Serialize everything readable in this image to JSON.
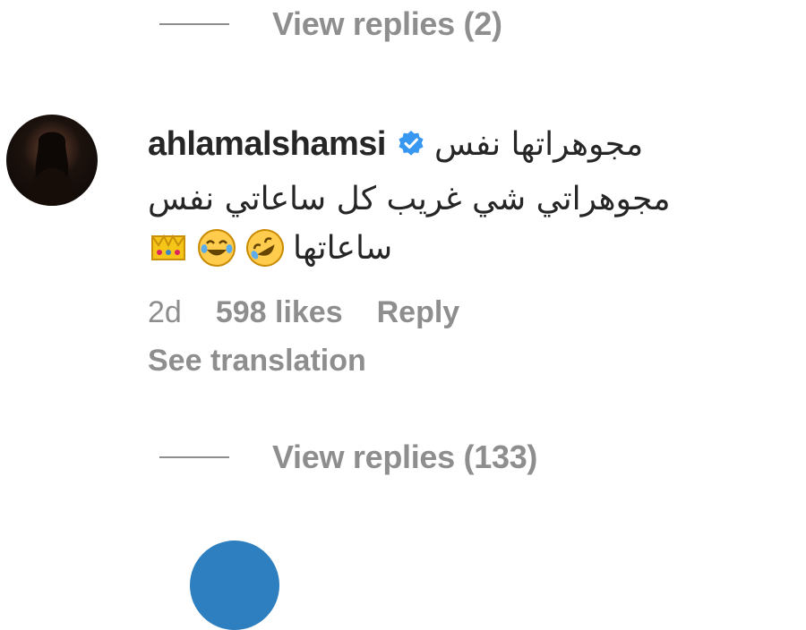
{
  "replies_top": {
    "label": "View replies (2)"
  },
  "comment": {
    "username": "ahlamalshamsi",
    "verified_icon": "verified-badge-icon",
    "text_line1": "مجوهراتها نفس",
    "text_line2": "مجوهراتي شي غريب كل ساعاتي نفس",
    "text_line3": "ساعاتها",
    "emojis": [
      "crown-icon",
      "joy-emoji-icon",
      "rofl-emoji-icon"
    ],
    "time": "2d",
    "likes": "598 likes",
    "reply": "Reply",
    "see_translation": "See translation"
  },
  "replies_bottom": {
    "label": "View replies (133)"
  },
  "colors": {
    "muted": "#8e8e8e",
    "text": "#262626",
    "verified": "#3897f0"
  }
}
